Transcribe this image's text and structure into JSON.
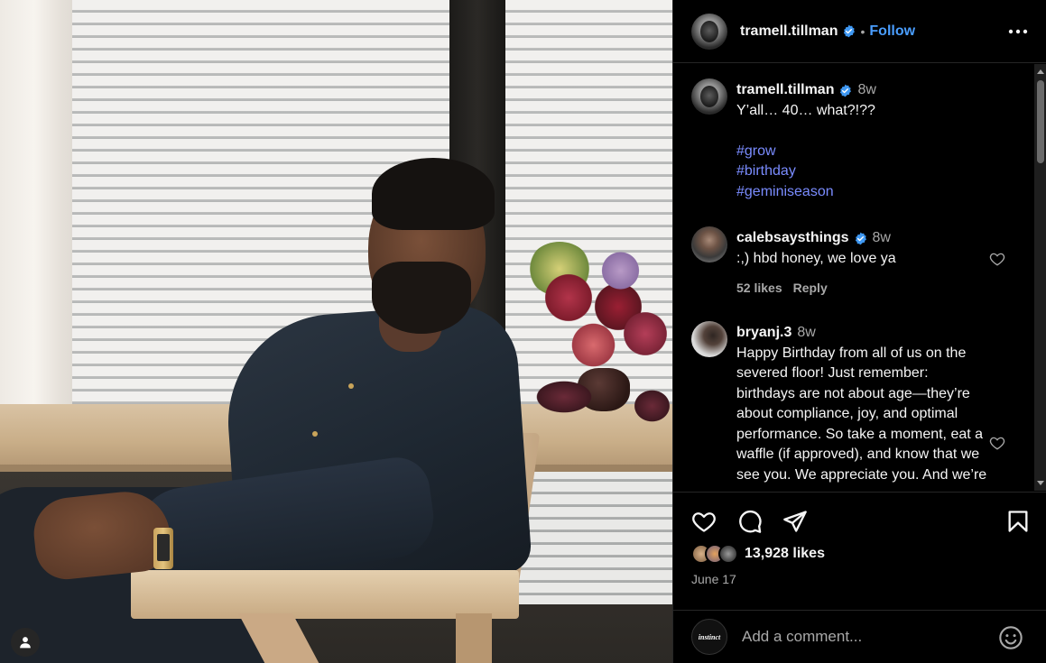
{
  "post": {
    "author": "tramell.tillman",
    "follow_label": "Follow",
    "separator": "•"
  },
  "caption": {
    "author": "tramell.tillman",
    "time": "8w",
    "text": "Y’all… 40… what?!??",
    "hashtags": [
      "#grow",
      "#birthday",
      "#geminiseason"
    ]
  },
  "comments": [
    {
      "author": "calebsaysthings",
      "verified": true,
      "time": "8w",
      "text": ":,) hbd honey, we love ya",
      "likes": "52 likes",
      "reply_label": "Reply"
    },
    {
      "author": "bryanj.3",
      "verified": false,
      "time": "8w",
      "text": "Happy Birthday from all of us on the severed floor! Just remember: birthdays are not about age—they’re about compliance, joy, and optimal performance. So take a moment, eat a waffle (if approved), and know that we see you. We appreciate you. And we’re"
    }
  ],
  "stats": {
    "likes": "13,928 likes",
    "date": "June 17"
  },
  "composer": {
    "avatar_text": "instinct",
    "placeholder": "Add a comment..."
  },
  "icons": {
    "verified": "verified-badge-icon",
    "more": "more-options-icon",
    "like": "heart-icon",
    "comment": "comment-icon",
    "share": "share-icon",
    "save": "bookmark-icon",
    "emoji": "emoji-icon",
    "profile": "user-icon"
  },
  "colors": {
    "accent": "#0095f6",
    "link": "#4a9eff",
    "hashtag": "#7a8cff",
    "background": "#000000",
    "muted": "#a8a8a8"
  }
}
